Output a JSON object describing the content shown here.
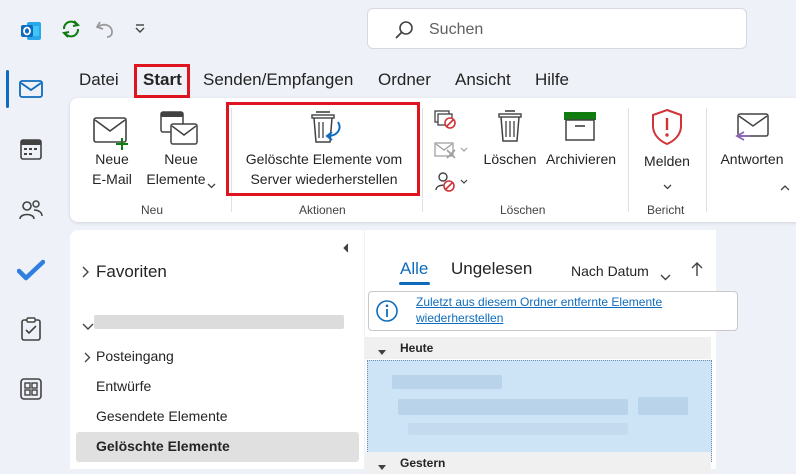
{
  "menu": {
    "tabs": [
      "Datei",
      "Start",
      "Senden/Empfangen",
      "Ordner",
      "Ansicht",
      "Hilfe"
    ]
  },
  "search": {
    "placeholder": "Suchen"
  },
  "ribbon": {
    "new_mail": [
      "Neue",
      "E-Mail"
    ],
    "new_items": [
      "Neue",
      "Elemente"
    ],
    "restore_deleted": [
      "Gelöschte Elemente vom",
      "Server wiederherstellen"
    ],
    "delete": "Löschen",
    "archive": "Archivieren",
    "report": "Melden",
    "reply": "Antworten",
    "groups": {
      "new": "Neu",
      "actions": "Aktionen",
      "delete": "Löschen",
      "report": "Bericht"
    }
  },
  "folders": {
    "favorites": "Favoriten",
    "items": [
      "Posteingang",
      "Entwürfe",
      "Gesendete Elemente",
      "Gelöschte Elemente"
    ]
  },
  "message_list": {
    "filter_all": "Alle",
    "filter_unread": "Ungelesen",
    "sort": "Nach Datum",
    "info_link": "Zuletzt aus diesem Ordner entfernte Elemente wiederherstellen",
    "group_today": "Heute",
    "group_yesterday": "Gestern"
  },
  "icons": {
    "app": "outlook-logo-icon",
    "sync": "sync-icon",
    "undo": "undo-icon",
    "qat": "customize-qat-icon",
    "rail": [
      "mail-icon",
      "calendar-icon",
      "people-icon",
      "todo-icon",
      "tasks-clipboard-icon",
      "apps-icon"
    ]
  },
  "colors": {
    "accent": "#0f6cbd",
    "highlight": "#e0141e",
    "selection": "#cce4f6"
  }
}
